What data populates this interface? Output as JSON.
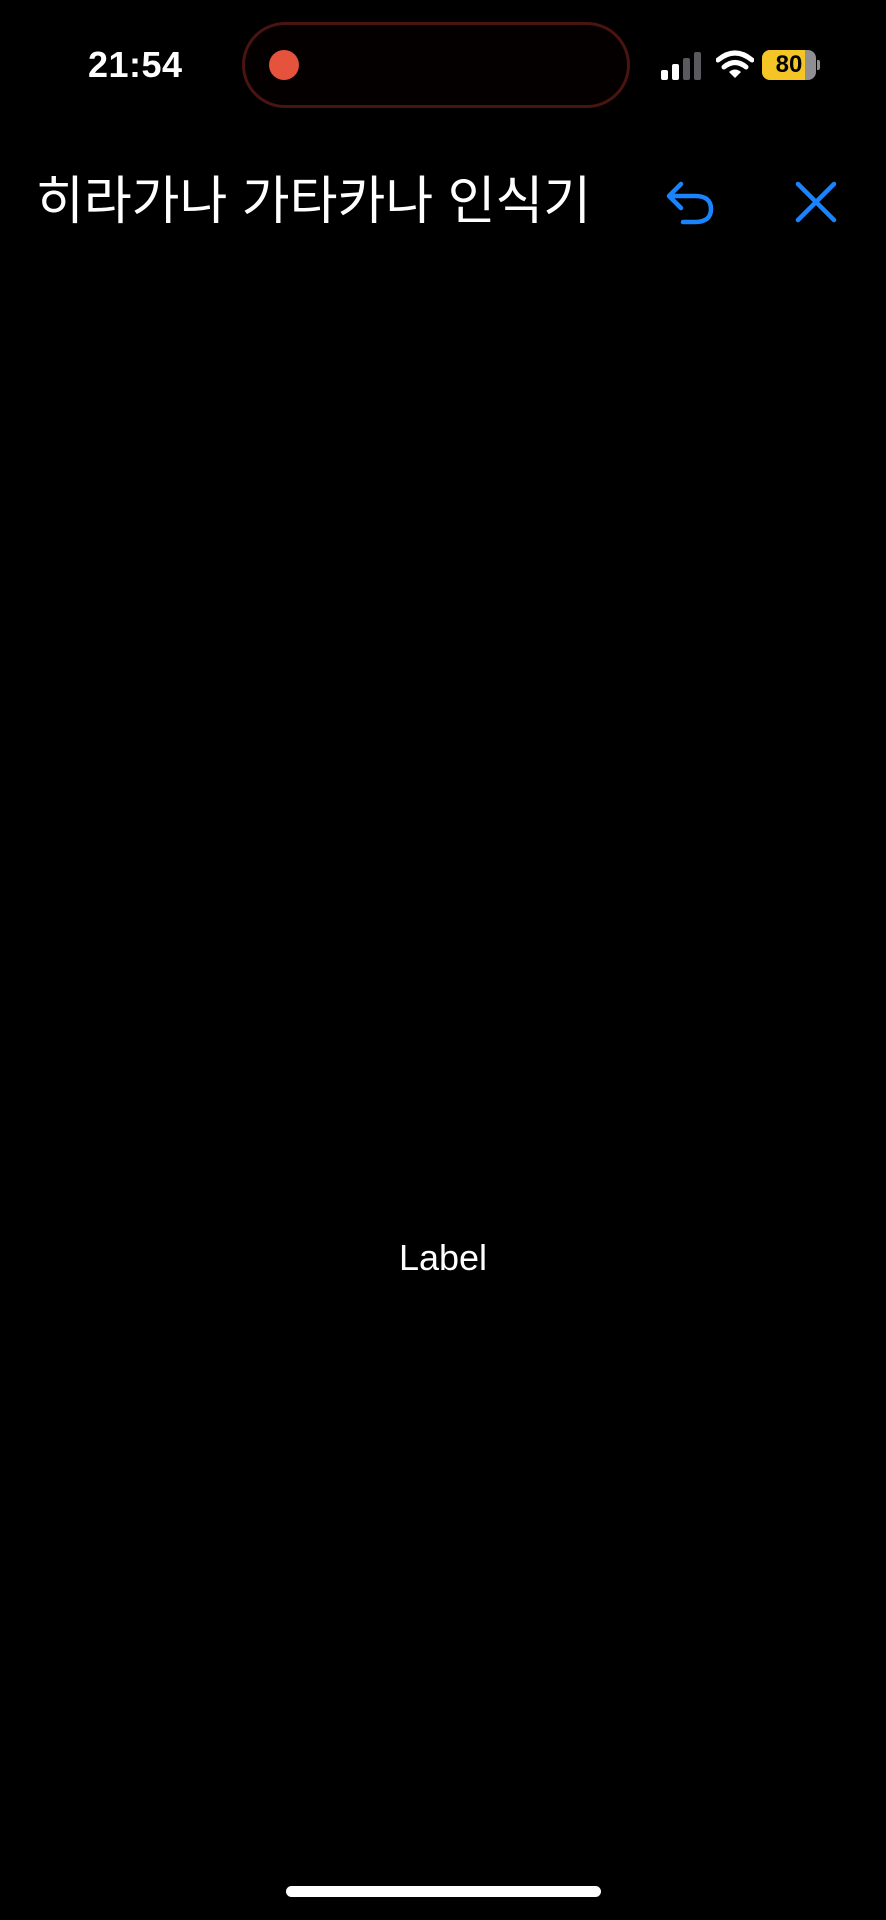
{
  "status_bar": {
    "time": "21:54",
    "recording_indicator_color": "#e5533c",
    "signal_icon": "cellular-signal-icon",
    "wifi_icon": "wifi-icon",
    "battery_percent": 80,
    "battery_label": "80",
    "battery_color": "#f5c425"
  },
  "nav": {
    "title": "히라가나 가타카나 인식기",
    "undo_icon": "undo-arrow-icon",
    "close_icon": "close-x-icon",
    "accent_color": "#1a84ff"
  },
  "main": {
    "label": "Label"
  }
}
